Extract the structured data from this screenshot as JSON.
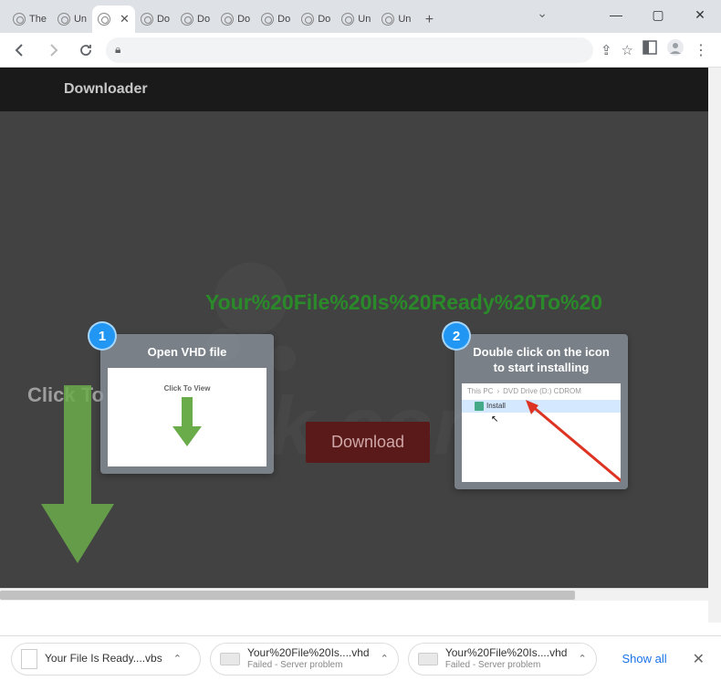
{
  "window": {
    "tabs": [
      {
        "label": "The",
        "active": false
      },
      {
        "label": "Un",
        "active": false
      },
      {
        "label": "",
        "active": true
      },
      {
        "label": "Do",
        "active": false
      },
      {
        "label": "Do",
        "active": false
      },
      {
        "label": "Do",
        "active": false
      },
      {
        "label": "Do",
        "active": false
      },
      {
        "label": "Do",
        "active": false
      },
      {
        "label": "Un",
        "active": false
      },
      {
        "label": "Un",
        "active": false
      }
    ]
  },
  "toolbar": {},
  "page": {
    "header": "Downloader",
    "title": "Your%20File%20Is%20Ready%20To%20",
    "click_to_view": "Click To View",
    "download_label": "Download",
    "card1": {
      "num": "1",
      "title": "Open VHD file",
      "inner_text": "Click To View"
    },
    "card2": {
      "num": "2",
      "title": "Double click on the icon to start installing",
      "path_a": "This PC",
      "path_b": "DVD Drive (D:) CDROM",
      "install": "Install"
    }
  },
  "downloads": {
    "items": [
      {
        "name": "Your File Is Ready....vbs",
        "sub": ""
      },
      {
        "name": "Your%20File%20Is....vhd",
        "sub": "Failed - Server problem"
      },
      {
        "name": "Your%20File%20Is....vhd",
        "sub": "Failed - Server problem"
      }
    ],
    "show_all": "Show all"
  }
}
